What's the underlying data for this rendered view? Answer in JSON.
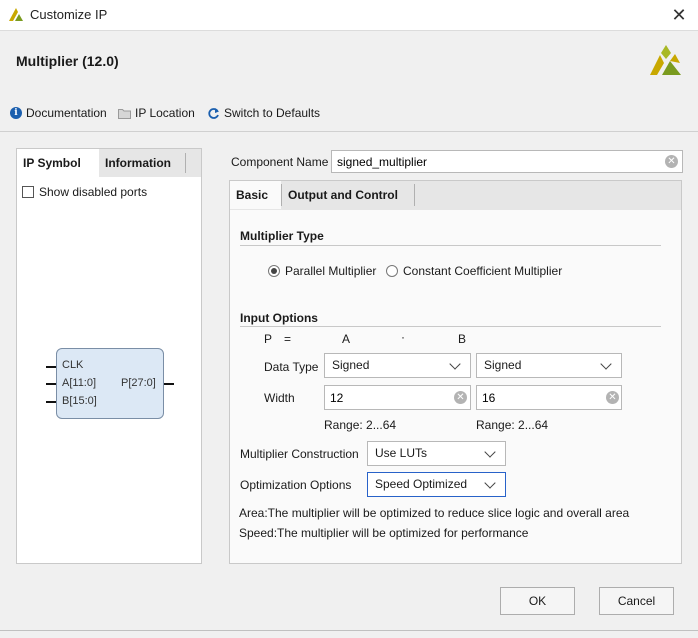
{
  "window": {
    "title": "Customize IP",
    "close_icon": "close-icon"
  },
  "header": {
    "ip_name": "Multiplier (12.0)"
  },
  "toolbar": {
    "documentation": "Documentation",
    "ip_location": "IP Location",
    "switch_defaults": "Switch to Defaults"
  },
  "left_panel": {
    "tabs": [
      "IP Symbol",
      "Information"
    ],
    "active_tab": "IP Symbol",
    "show_disabled_ports": {
      "label": "Show disabled ports",
      "checked": false
    },
    "symbol": {
      "inputs": [
        "CLK",
        "A[11:0]",
        "B[15:0]"
      ],
      "outputs": [
        "P[27:0]"
      ]
    }
  },
  "component": {
    "label": "Component Name",
    "value": "signed_multiplier"
  },
  "right_panel": {
    "tabs": [
      "Basic",
      "Output and Control"
    ],
    "active_tab": "Basic",
    "multiplier_type": {
      "title": "Multiplier Type",
      "options": [
        {
          "label": "Parallel Multiplier",
          "selected": true
        },
        {
          "label": "Constant Coefficient Multiplier",
          "selected": false
        }
      ]
    },
    "input_options": {
      "title": "Input Options",
      "equation": {
        "p": "P",
        "eq": "=",
        "a": "A",
        "dot": "·",
        "b": "B"
      },
      "data_type_label": "Data Type",
      "data_type_a": "Signed",
      "data_type_b": "Signed",
      "width_label": "Width",
      "width_a": "12",
      "width_b": "16",
      "range_a": "Range: 2...64",
      "range_b": "Range: 2...64"
    },
    "construction": {
      "label": "Multiplier Construction",
      "value": "Use LUTs"
    },
    "optimization": {
      "label": "Optimization Options",
      "value": "Speed Optimized"
    },
    "notes": [
      "Area:The multiplier will be optimized to reduce slice logic and overall area",
      "Speed:The multiplier will be optimized for performance"
    ]
  },
  "buttons": {
    "ok": "OK",
    "cancel": "Cancel"
  },
  "colors": {
    "brand_yellow": "#c8a800",
    "brand_green": "#7a9b1f",
    "accent_blue": "#1b5fae",
    "focus_border": "#2862c9",
    "symbol_fill": "#dce8f5"
  }
}
